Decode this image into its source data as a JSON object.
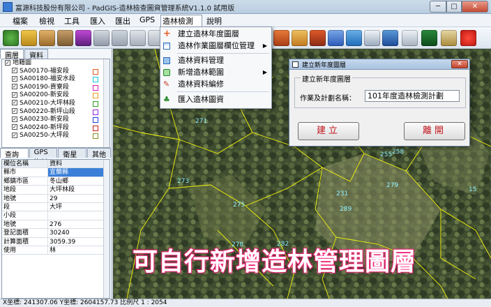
{
  "window": {
    "title": "富源科技股份有限公司 - PadGIS-造林檢查圖資管理系統V1.1.0 試用版",
    "min_label": "─",
    "max_label": "□",
    "close_label": "✕"
  },
  "menu": {
    "items": [
      "檔案",
      "檢視",
      "工具",
      "匯入",
      "匯出",
      "GPS",
      "造林檢測",
      "說明"
    ],
    "active": "造林檢測"
  },
  "dropdown": {
    "items": [
      {
        "label": "建立造林年度圖層",
        "icon": "plus-icon",
        "submenu": false
      },
      {
        "label": "造林作業圖層欄位管理",
        "icon": "table-icon",
        "submenu": true
      },
      {
        "label": "造林資料管理",
        "icon": "database-icon",
        "submenu": false
      },
      {
        "label": "新增造林範圍",
        "icon": "polygon-add-icon",
        "submenu": true
      },
      {
        "label": "造林資料編修",
        "icon": "pencil-icon",
        "submenu": false
      },
      {
        "label": "匯入造林圖資",
        "icon": "tree-import-icon",
        "submenu": false
      }
    ]
  },
  "left_panel": {
    "tabs": [
      "圖層",
      "資料"
    ],
    "tree_root": "地籍圖",
    "layers": [
      {
        "name": "SA00170-福安段",
        "color": "#e05a1e"
      },
      {
        "name": "SA00180-福安水段",
        "color": "#18c9d6"
      },
      {
        "name": "SA00190-貢寮段",
        "color": "#d61eb7"
      },
      {
        "name": "SA00200-新安段",
        "color": "#e8a31e"
      },
      {
        "name": "SA00210-大坪林段",
        "color": "#2f9b2a"
      },
      {
        "name": "SA00220-新坪山段",
        "color": "#8c2ad6"
      },
      {
        "name": "SA00230-新安段",
        "color": "#1e3ce0"
      },
      {
        "name": "SA00240-新坪段",
        "color": "#c91e1e"
      },
      {
        "name": "SA00250-大坪段",
        "color": "#8a8a1e"
      }
    ],
    "tabs2": [
      "查詢結果",
      "GPS資料",
      "衛星資訊",
      "其他區"
    ],
    "table_header": [
      "欄位名稱",
      "資料"
    ],
    "table_rows": [
      [
        "縣市",
        "宜蘭縣"
      ],
      [
        "鄉鎮市區",
        "冬山鄉"
      ],
      [
        "地段",
        "大坪林段"
      ],
      [
        "地號",
        "29"
      ],
      [
        "段",
        "大坪"
      ],
      [
        "小段",
        ""
      ],
      [
        "地號",
        "276"
      ],
      [
        "登記面積",
        "30240"
      ],
      [
        "計算面積",
        "3059.39"
      ],
      [
        "使用",
        "林"
      ]
    ],
    "highlight_row": 0
  },
  "map": {
    "parcel_labels": [
      "271",
      "273",
      "275",
      "278",
      "231",
      "255",
      "258",
      "279",
      "282",
      "289",
      "15"
    ],
    "overlay_caption": "可自行新增造林管理圖層"
  },
  "dialog": {
    "title": "建立新年度圖層",
    "group_label": "建立新年度圖層",
    "field_label": "作業及計劃名稱：",
    "field_value": "101年度造林檢測計劃",
    "create_button": "建立",
    "leave_button": "離開",
    "close_label": "✕"
  },
  "status": {
    "text": "X坐標: 241307.06  Y坐標: 2604157.73  比例尺 1 : 2054"
  },
  "colors": {
    "accent": "#3b7fd8",
    "parcel_line": "#f2f20a",
    "caption_stroke": "#d81e6a",
    "button_text": "#c0141b"
  }
}
